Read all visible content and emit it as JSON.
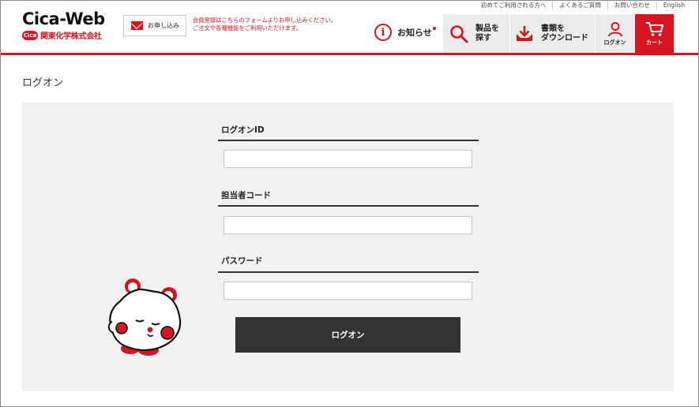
{
  "header": {
    "logo_title": "Cica-Web",
    "logo_mark": "Cica",
    "logo_company": "関東化学株式会社",
    "apply_label": "お申し込み",
    "notice_line1": "会員登録はこちらのフォームよりお申し込みください。",
    "notice_line2": "ご注文や各種機能をご利用いただけます。",
    "top_links": [
      "初めてご利用される方へ",
      "よくあるご質問",
      "お問い合わせ",
      "English"
    ],
    "news_label": "お知らせ",
    "search_line1": "製品を",
    "search_line2": "探す",
    "download_line1": "書類を",
    "download_line2": "ダウンロード",
    "logon_label": "ログオン",
    "cart_label": "カート"
  },
  "page": {
    "title": "ログオン"
  },
  "form": {
    "logon_id_label": "ログオンID",
    "logon_id_value": "",
    "staff_code_label": "担当者コード",
    "staff_code_value": "",
    "password_label": "パスワード",
    "password_value": "",
    "submit_label": "ログオン"
  },
  "colors": {
    "accent": "#d7141f",
    "panel": "#f1f1f1",
    "button": "#333333"
  }
}
